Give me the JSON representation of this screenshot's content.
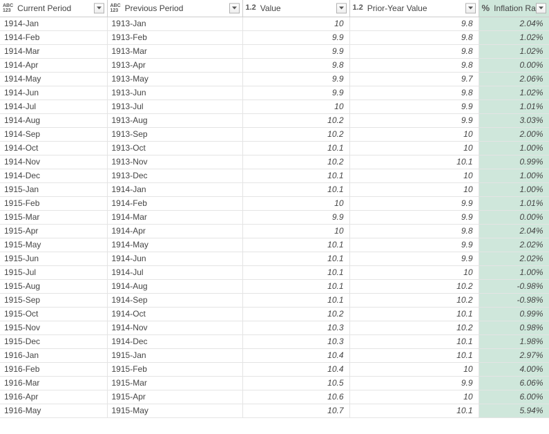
{
  "headers": {
    "current": {
      "label": "Current Period",
      "type": "abc123"
    },
    "previous": {
      "label": "Previous Period",
      "type": "abc123"
    },
    "value": {
      "label": "Value",
      "type": "1.2"
    },
    "prior": {
      "label": "Prior-Year Value",
      "type": "1.2"
    },
    "inflation": {
      "label": "Inflation Rate",
      "type": "%"
    }
  },
  "rows": [
    {
      "current": "1914-Jan",
      "previous": "1913-Jan",
      "value": "10",
      "prior": "9.8",
      "inflation": "2.04%"
    },
    {
      "current": "1914-Feb",
      "previous": "1913-Feb",
      "value": "9.9",
      "prior": "9.8",
      "inflation": "1.02%"
    },
    {
      "current": "1914-Mar",
      "previous": "1913-Mar",
      "value": "9.9",
      "prior": "9.8",
      "inflation": "1.02%"
    },
    {
      "current": "1914-Apr",
      "previous": "1913-Apr",
      "value": "9.8",
      "prior": "9.8",
      "inflation": "0.00%"
    },
    {
      "current": "1914-May",
      "previous": "1913-May",
      "value": "9.9",
      "prior": "9.7",
      "inflation": "2.06%"
    },
    {
      "current": "1914-Jun",
      "previous": "1913-Jun",
      "value": "9.9",
      "prior": "9.8",
      "inflation": "1.02%"
    },
    {
      "current": "1914-Jul",
      "previous": "1913-Jul",
      "value": "10",
      "prior": "9.9",
      "inflation": "1.01%"
    },
    {
      "current": "1914-Aug",
      "previous": "1913-Aug",
      "value": "10.2",
      "prior": "9.9",
      "inflation": "3.03%"
    },
    {
      "current": "1914-Sep",
      "previous": "1913-Sep",
      "value": "10.2",
      "prior": "10",
      "inflation": "2.00%"
    },
    {
      "current": "1914-Oct",
      "previous": "1913-Oct",
      "value": "10.1",
      "prior": "10",
      "inflation": "1.00%"
    },
    {
      "current": "1914-Nov",
      "previous": "1913-Nov",
      "value": "10.2",
      "prior": "10.1",
      "inflation": "0.99%"
    },
    {
      "current": "1914-Dec",
      "previous": "1913-Dec",
      "value": "10.1",
      "prior": "10",
      "inflation": "1.00%"
    },
    {
      "current": "1915-Jan",
      "previous": "1914-Jan",
      "value": "10.1",
      "prior": "10",
      "inflation": "1.00%"
    },
    {
      "current": "1915-Feb",
      "previous": "1914-Feb",
      "value": "10",
      "prior": "9.9",
      "inflation": "1.01%"
    },
    {
      "current": "1915-Mar",
      "previous": "1914-Mar",
      "value": "9.9",
      "prior": "9.9",
      "inflation": "0.00%"
    },
    {
      "current": "1915-Apr",
      "previous": "1914-Apr",
      "value": "10",
      "prior": "9.8",
      "inflation": "2.04%"
    },
    {
      "current": "1915-May",
      "previous": "1914-May",
      "value": "10.1",
      "prior": "9.9",
      "inflation": "2.02%"
    },
    {
      "current": "1915-Jun",
      "previous": "1914-Jun",
      "value": "10.1",
      "prior": "9.9",
      "inflation": "2.02%"
    },
    {
      "current": "1915-Jul",
      "previous": "1914-Jul",
      "value": "10.1",
      "prior": "10",
      "inflation": "1.00%"
    },
    {
      "current": "1915-Aug",
      "previous": "1914-Aug",
      "value": "10.1",
      "prior": "10.2",
      "inflation": "-0.98%"
    },
    {
      "current": "1915-Sep",
      "previous": "1914-Sep",
      "value": "10.1",
      "prior": "10.2",
      "inflation": "-0.98%"
    },
    {
      "current": "1915-Oct",
      "previous": "1914-Oct",
      "value": "10.2",
      "prior": "10.1",
      "inflation": "0.99%"
    },
    {
      "current": "1915-Nov",
      "previous": "1914-Nov",
      "value": "10.3",
      "prior": "10.2",
      "inflation": "0.98%"
    },
    {
      "current": "1915-Dec",
      "previous": "1914-Dec",
      "value": "10.3",
      "prior": "10.1",
      "inflation": "1.98%"
    },
    {
      "current": "1916-Jan",
      "previous": "1915-Jan",
      "value": "10.4",
      "prior": "10.1",
      "inflation": "2.97%"
    },
    {
      "current": "1916-Feb",
      "previous": "1915-Feb",
      "value": "10.4",
      "prior": "10",
      "inflation": "4.00%"
    },
    {
      "current": "1916-Mar",
      "previous": "1915-Mar",
      "value": "10.5",
      "prior": "9.9",
      "inflation": "6.06%"
    },
    {
      "current": "1916-Apr",
      "previous": "1915-Apr",
      "value": "10.6",
      "prior": "10",
      "inflation": "6.00%"
    },
    {
      "current": "1916-May",
      "previous": "1915-May",
      "value": "10.7",
      "prior": "10.1",
      "inflation": "5.94%"
    }
  ]
}
